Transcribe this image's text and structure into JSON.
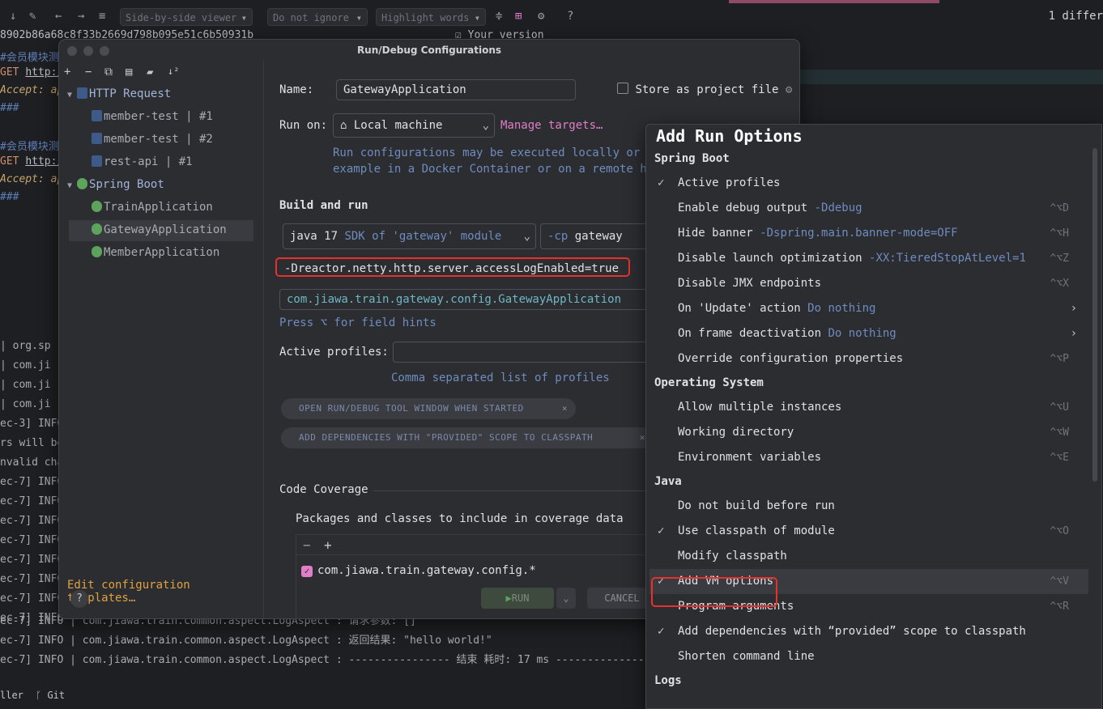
{
  "toolbar": {
    "viewer": "Side-by-side viewer",
    "ignore": "Do not ignore",
    "highlight": "Highlight words",
    "help": "?",
    "diff_count": "1 differ",
    "hash": "8902b86a68c8f33b2669d798b095e51c6b50931b",
    "your_version": "Your version"
  },
  "editor": {
    "comment1": "#会员模块测",
    "get1_method": "GET",
    "get1_url": "http:/",
    "accept1": "Accept: ap",
    "sep1": "###",
    "comment2": "#会员模块测",
    "get2_method": "GET",
    "get2_url": "http:/",
    "accept2": "Accept: ap",
    "sep2": "###",
    "log_lines": [
      "  | org.sp",
      "  | com.ji",
      "  | com.ji",
      "  | com.ji",
      "ec-3] INFO",
      "rs will be",
      "nvalid cha",
      "ec-7] INFO",
      "ec-7] INFO",
      "ec-7] INFO",
      "ec-7] INFO",
      "ec-7] INFO",
      "ec-7] INFO",
      "ec-7] INFO",
      "ec-7] INFO"
    ],
    "log_tail1": "ec-7] INFO  | com.jiawa.train.common.aspect.LogAspect : 请求参数: []",
    "log_tail2": "ec-7] INFO  | com.jiawa.train.common.aspect.LogAspect : 返回结果: \"hello world!\"",
    "log_tail3": "ec-7] INFO  | com.jiawa.train.common.aspect.LogAspect : ---------------- 结束 耗时: 17 ms ----------------",
    "bottom_left": "ller",
    "bottom_git": "Git"
  },
  "dialog": {
    "title": "Run/Debug Configurations",
    "tree": {
      "http_group": "HTTP Request",
      "http_items": [
        "member-test | #1",
        "member-test | #2",
        "rest-api | #1"
      ],
      "spring_group": "Spring Boot",
      "spring_items": [
        "TrainApplication",
        "GatewayApplication",
        "MemberApplication"
      ]
    },
    "edit_templates": "Edit configuration templates…",
    "help": "?",
    "name_label": "Name:",
    "name_value": "GatewayApplication",
    "store_label": "Store as project file",
    "run_on_label": "Run on:",
    "run_on_value": "Local machine",
    "manage_targets": "Manage targets…",
    "run_on_hint1": "Run configurations may be executed locally or on",
    "run_on_hint2": "example in a Docker Container or on a remote host",
    "build_run": "Build and run",
    "sdk_value": "java 17",
    "sdk_hint": "SDK of 'gateway' module",
    "cp_flag": "-cp",
    "cp_value": "gateway",
    "vm_options": "-Dreactor.netty.http.server.accessLogEnabled=true",
    "main_class": "com.jiawa.train.gateway.config.GatewayApplication",
    "field_hints": "Press ⌥ for field hints",
    "active_profiles_label": "Active profiles:",
    "active_profiles_hint": "Comma separated list of profiles",
    "pill1": "OPEN RUN/DEBUG TOOL WINDOW WHEN STARTED",
    "pill2": "ADD DEPENDENCIES WITH \"PROVIDED\" SCOPE TO CLASSPATH",
    "code_coverage": "Code Coverage",
    "packages_label": "Packages and classes to include in coverage data",
    "coverage_item": "com.jiawa.train.gateway.config.*",
    "run_btn": "RUN",
    "cancel_btn": "CANCEL"
  },
  "popup": {
    "title": "Add Run Options",
    "sections": [
      {
        "header": "Spring Boot",
        "items": [
          {
            "label": "Active profiles",
            "sub": "",
            "shortcut": "",
            "checked": true
          },
          {
            "label": "Enable debug output",
            "sub": "-Ddebug",
            "shortcut": "^⌥D",
            "checked": false
          },
          {
            "label": "Hide banner",
            "sub": "-Dspring.main.banner-mode=OFF",
            "shortcut": "^⌥H",
            "checked": false
          },
          {
            "label": "Disable launch optimization",
            "sub": "-XX:TieredStopAtLevel=1",
            "shortcut": "^⌥Z",
            "checked": false
          },
          {
            "label": "Disable JMX endpoints",
            "sub": "",
            "shortcut": "^⌥X",
            "checked": false
          },
          {
            "label": "On 'Update' action",
            "sub": "Do nothing",
            "shortcut": "",
            "submenu": true,
            "checked": false
          },
          {
            "label": "On frame deactivation",
            "sub": "Do nothing",
            "shortcut": "",
            "submenu": true,
            "checked": false
          },
          {
            "label": "Override configuration properties",
            "sub": "",
            "shortcut": "^⌥P",
            "checked": false
          }
        ]
      },
      {
        "header": "Operating System",
        "items": [
          {
            "label": "Allow multiple instances",
            "sub": "",
            "shortcut": "^⌥U",
            "checked": false
          },
          {
            "label": "Working directory",
            "sub": "",
            "shortcut": "^⌥W",
            "checked": false
          },
          {
            "label": "Environment variables",
            "sub": "",
            "shortcut": "^⌥E",
            "checked": false
          }
        ]
      },
      {
        "header": "Java",
        "items": [
          {
            "label": "Do not build before run",
            "sub": "",
            "shortcut": "",
            "checked": false
          },
          {
            "label": "Use classpath of module",
            "sub": "",
            "shortcut": "^⌥O",
            "checked": true
          },
          {
            "label": "Modify classpath",
            "sub": "",
            "shortcut": "",
            "checked": false
          },
          {
            "label": "Add VM options",
            "sub": "",
            "shortcut": "^⌥V",
            "checked": true,
            "selected": true
          },
          {
            "label": "Program arguments",
            "sub": "",
            "shortcut": "^⌥R",
            "checked": false
          },
          {
            "label": "Add dependencies with “provided” scope to classpath",
            "sub": "",
            "shortcut": "",
            "checked": true
          },
          {
            "label": "Shorten command line",
            "sub": "",
            "shortcut": "",
            "checked": false
          }
        ]
      },
      {
        "header": "Logs",
        "items": []
      }
    ]
  }
}
